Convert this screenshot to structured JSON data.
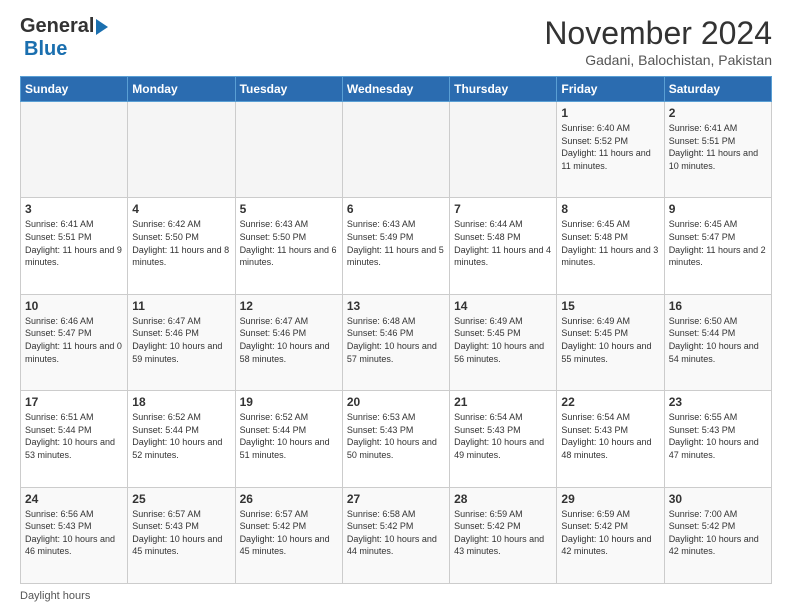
{
  "header": {
    "logo_line1": "General",
    "logo_line2": "Blue",
    "month_title": "November 2024",
    "location": "Gadani, Balochistan, Pakistan"
  },
  "days_of_week": [
    "Sunday",
    "Monday",
    "Tuesday",
    "Wednesday",
    "Thursday",
    "Friday",
    "Saturday"
  ],
  "footer": {
    "label": "Daylight hours"
  },
  "weeks": [
    [
      {
        "day": "",
        "info": ""
      },
      {
        "day": "",
        "info": ""
      },
      {
        "day": "",
        "info": ""
      },
      {
        "day": "",
        "info": ""
      },
      {
        "day": "",
        "info": ""
      },
      {
        "day": "1",
        "info": "Sunrise: 6:40 AM\nSunset: 5:52 PM\nDaylight: 11 hours and 11 minutes."
      },
      {
        "day": "2",
        "info": "Sunrise: 6:41 AM\nSunset: 5:51 PM\nDaylight: 11 hours and 10 minutes."
      }
    ],
    [
      {
        "day": "3",
        "info": "Sunrise: 6:41 AM\nSunset: 5:51 PM\nDaylight: 11 hours and 9 minutes."
      },
      {
        "day": "4",
        "info": "Sunrise: 6:42 AM\nSunset: 5:50 PM\nDaylight: 11 hours and 8 minutes."
      },
      {
        "day": "5",
        "info": "Sunrise: 6:43 AM\nSunset: 5:50 PM\nDaylight: 11 hours and 6 minutes."
      },
      {
        "day": "6",
        "info": "Sunrise: 6:43 AM\nSunset: 5:49 PM\nDaylight: 11 hours and 5 minutes."
      },
      {
        "day": "7",
        "info": "Sunrise: 6:44 AM\nSunset: 5:48 PM\nDaylight: 11 hours and 4 minutes."
      },
      {
        "day": "8",
        "info": "Sunrise: 6:45 AM\nSunset: 5:48 PM\nDaylight: 11 hours and 3 minutes."
      },
      {
        "day": "9",
        "info": "Sunrise: 6:45 AM\nSunset: 5:47 PM\nDaylight: 11 hours and 2 minutes."
      }
    ],
    [
      {
        "day": "10",
        "info": "Sunrise: 6:46 AM\nSunset: 5:47 PM\nDaylight: 11 hours and 0 minutes."
      },
      {
        "day": "11",
        "info": "Sunrise: 6:47 AM\nSunset: 5:46 PM\nDaylight: 10 hours and 59 minutes."
      },
      {
        "day": "12",
        "info": "Sunrise: 6:47 AM\nSunset: 5:46 PM\nDaylight: 10 hours and 58 minutes."
      },
      {
        "day": "13",
        "info": "Sunrise: 6:48 AM\nSunset: 5:46 PM\nDaylight: 10 hours and 57 minutes."
      },
      {
        "day": "14",
        "info": "Sunrise: 6:49 AM\nSunset: 5:45 PM\nDaylight: 10 hours and 56 minutes."
      },
      {
        "day": "15",
        "info": "Sunrise: 6:49 AM\nSunset: 5:45 PM\nDaylight: 10 hours and 55 minutes."
      },
      {
        "day": "16",
        "info": "Sunrise: 6:50 AM\nSunset: 5:44 PM\nDaylight: 10 hours and 54 minutes."
      }
    ],
    [
      {
        "day": "17",
        "info": "Sunrise: 6:51 AM\nSunset: 5:44 PM\nDaylight: 10 hours and 53 minutes."
      },
      {
        "day": "18",
        "info": "Sunrise: 6:52 AM\nSunset: 5:44 PM\nDaylight: 10 hours and 52 minutes."
      },
      {
        "day": "19",
        "info": "Sunrise: 6:52 AM\nSunset: 5:44 PM\nDaylight: 10 hours and 51 minutes."
      },
      {
        "day": "20",
        "info": "Sunrise: 6:53 AM\nSunset: 5:43 PM\nDaylight: 10 hours and 50 minutes."
      },
      {
        "day": "21",
        "info": "Sunrise: 6:54 AM\nSunset: 5:43 PM\nDaylight: 10 hours and 49 minutes."
      },
      {
        "day": "22",
        "info": "Sunrise: 6:54 AM\nSunset: 5:43 PM\nDaylight: 10 hours and 48 minutes."
      },
      {
        "day": "23",
        "info": "Sunrise: 6:55 AM\nSunset: 5:43 PM\nDaylight: 10 hours and 47 minutes."
      }
    ],
    [
      {
        "day": "24",
        "info": "Sunrise: 6:56 AM\nSunset: 5:43 PM\nDaylight: 10 hours and 46 minutes."
      },
      {
        "day": "25",
        "info": "Sunrise: 6:57 AM\nSunset: 5:43 PM\nDaylight: 10 hours and 45 minutes."
      },
      {
        "day": "26",
        "info": "Sunrise: 6:57 AM\nSunset: 5:42 PM\nDaylight: 10 hours and 45 minutes."
      },
      {
        "day": "27",
        "info": "Sunrise: 6:58 AM\nSunset: 5:42 PM\nDaylight: 10 hours and 44 minutes."
      },
      {
        "day": "28",
        "info": "Sunrise: 6:59 AM\nSunset: 5:42 PM\nDaylight: 10 hours and 43 minutes."
      },
      {
        "day": "29",
        "info": "Sunrise: 6:59 AM\nSunset: 5:42 PM\nDaylight: 10 hours and 42 minutes."
      },
      {
        "day": "30",
        "info": "Sunrise: 7:00 AM\nSunset: 5:42 PM\nDaylight: 10 hours and 42 minutes."
      }
    ]
  ]
}
